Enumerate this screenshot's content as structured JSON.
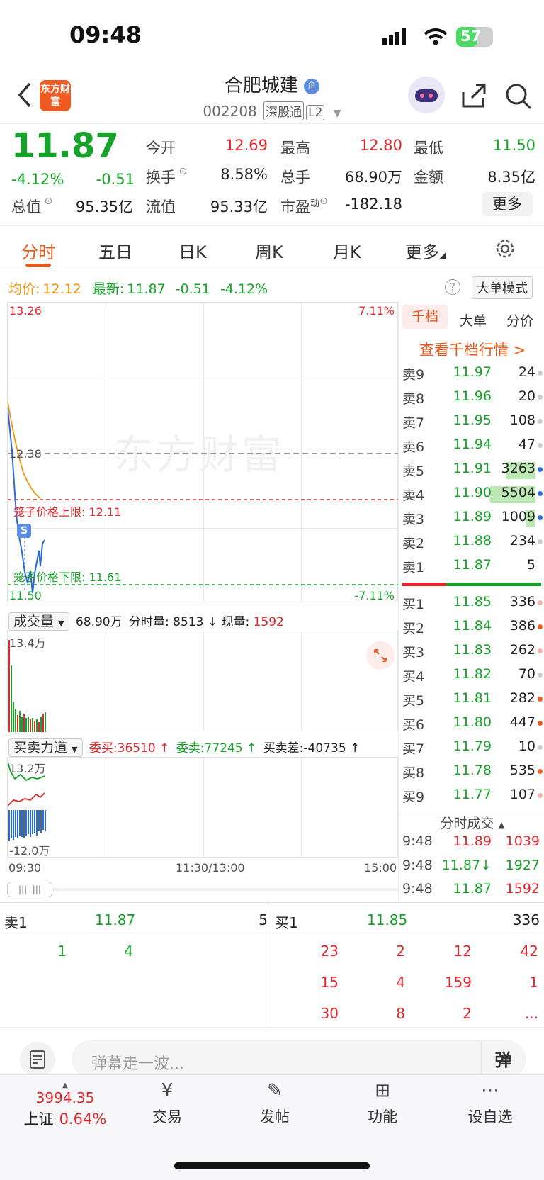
{
  "status": {
    "time": "09:48",
    "battery": "57"
  },
  "header": {
    "logo_text": "东方财富",
    "name": "合肥城建",
    "name_badge": "企",
    "code": "002208",
    "tags": [
      "深股通",
      "L2"
    ]
  },
  "quote": {
    "price": "11.87",
    "change_pct": "-4.12%",
    "change": "-0.51",
    "fields": [
      {
        "label": "今开",
        "value": "12.69",
        "color": "red"
      },
      {
        "label": "最高",
        "value": "12.80",
        "color": "red"
      },
      {
        "label": "最低",
        "value": "11.50",
        "color": "green"
      },
      {
        "label": "换手",
        "value": "8.58%"
      },
      {
        "label": "总手",
        "value": "68.90万"
      },
      {
        "label": "金额",
        "value": "8.35亿"
      },
      {
        "label": "总值",
        "value": "95.35亿"
      },
      {
        "label": "流值",
        "value": "95.33亿"
      },
      {
        "label": "市盈",
        "label_sup": "动",
        "value": "-182.18"
      }
    ],
    "more_label": "更多"
  },
  "tabs": [
    "分时",
    "五日",
    "日K",
    "周K",
    "月K",
    "更多"
  ],
  "chart": {
    "avg_label": "均价:",
    "avg_value": "12.12",
    "latest_label": "最新:",
    "latest_value": "11.87",
    "latest_change": "-0.51",
    "latest_pct": "-4.12%",
    "big_order_label": "大单模式",
    "y_top": "13.26",
    "y_top_pct": "7.11%",
    "y_mid": "12.38",
    "y_bottom": "11.50",
    "y_bottom_pct": "-7.11%",
    "upper_limit": "笼子价格上限: 12.11",
    "lower_limit": "笼子价格下限: 11.61",
    "watermark": "东方财富",
    "volume_selector": "成交量",
    "volume_total": "68.90万",
    "volume_detail": "分时量: 8513 ↓ 现量:",
    "volume_now": "1592",
    "volume_max": "13.4万",
    "force_selector": "买卖力道",
    "force_buy": "委买:36510 ↑",
    "force_sell": "委卖:77245 ↑",
    "force_diff": "买卖差:-40735 ↑",
    "force_max": "13.2万",
    "force_min": "-12.0万",
    "time_start": "09:30",
    "time_mid": "11:30/13:00",
    "time_end": "15:00"
  },
  "order_book": {
    "tabs": [
      "千档",
      "大单",
      "分价"
    ],
    "link": "查看千档行情 >",
    "asks": [
      {
        "label": "卖9",
        "price": "11.97",
        "qty": "24"
      },
      {
        "label": "卖8",
        "price": "11.96",
        "qty": "20"
      },
      {
        "label": "卖7",
        "price": "11.95",
        "qty": "108"
      },
      {
        "label": "卖6",
        "price": "11.94",
        "qty": "47"
      },
      {
        "label": "卖5",
        "price": "11.91",
        "qty": "3263"
      },
      {
        "label": "卖4",
        "price": "11.90",
        "qty": "5504"
      },
      {
        "label": "卖3",
        "price": "11.89",
        "qty": "1009"
      },
      {
        "label": "卖2",
        "price": "11.88",
        "qty": "234"
      },
      {
        "label": "卖1",
        "price": "11.87",
        "qty": "5"
      }
    ],
    "bids": [
      {
        "label": "买1",
        "price": "11.85",
        "qty": "336"
      },
      {
        "label": "买2",
        "price": "11.84",
        "qty": "386"
      },
      {
        "label": "买3",
        "price": "11.83",
        "qty": "262"
      },
      {
        "label": "买4",
        "price": "11.82",
        "qty": "70"
      },
      {
        "label": "买5",
        "price": "11.81",
        "qty": "282"
      },
      {
        "label": "买6",
        "price": "11.80",
        "qty": "447"
      },
      {
        "label": "买7",
        "price": "11.79",
        "qty": "10"
      },
      {
        "label": "买8",
        "price": "11.78",
        "qty": "535"
      },
      {
        "label": "买9",
        "price": "11.77",
        "qty": "107"
      }
    ],
    "ticks_title": "分时成交",
    "ticks": [
      {
        "time": "9:48",
        "price": "11.89",
        "qty": "1039"
      },
      {
        "time": "9:48",
        "price": "11.87↓",
        "qty": "1927"
      },
      {
        "time": "9:48",
        "price": "11.87",
        "qty": "1592"
      }
    ]
  },
  "queue": {
    "ask_label": "卖1",
    "ask_price": "11.87",
    "ask_qty": "5",
    "bid_label": "买1",
    "bid_price": "11.85",
    "bid_qty": "336",
    "ask_orders": [
      "1",
      "4"
    ],
    "bid_orders": [
      "23",
      "2",
      "12",
      "42",
      "15",
      "4",
      "159",
      "1",
      "30",
      "8",
      "2",
      "..."
    ]
  },
  "comment": {
    "placeholder": "弹幕走一波...",
    "danmu": "弹"
  },
  "nav": {
    "index_value": "3994.35",
    "index_name": "上证",
    "index_pct": "0.64%",
    "items": [
      "交易",
      "发帖",
      "功能",
      "设自选"
    ]
  }
}
